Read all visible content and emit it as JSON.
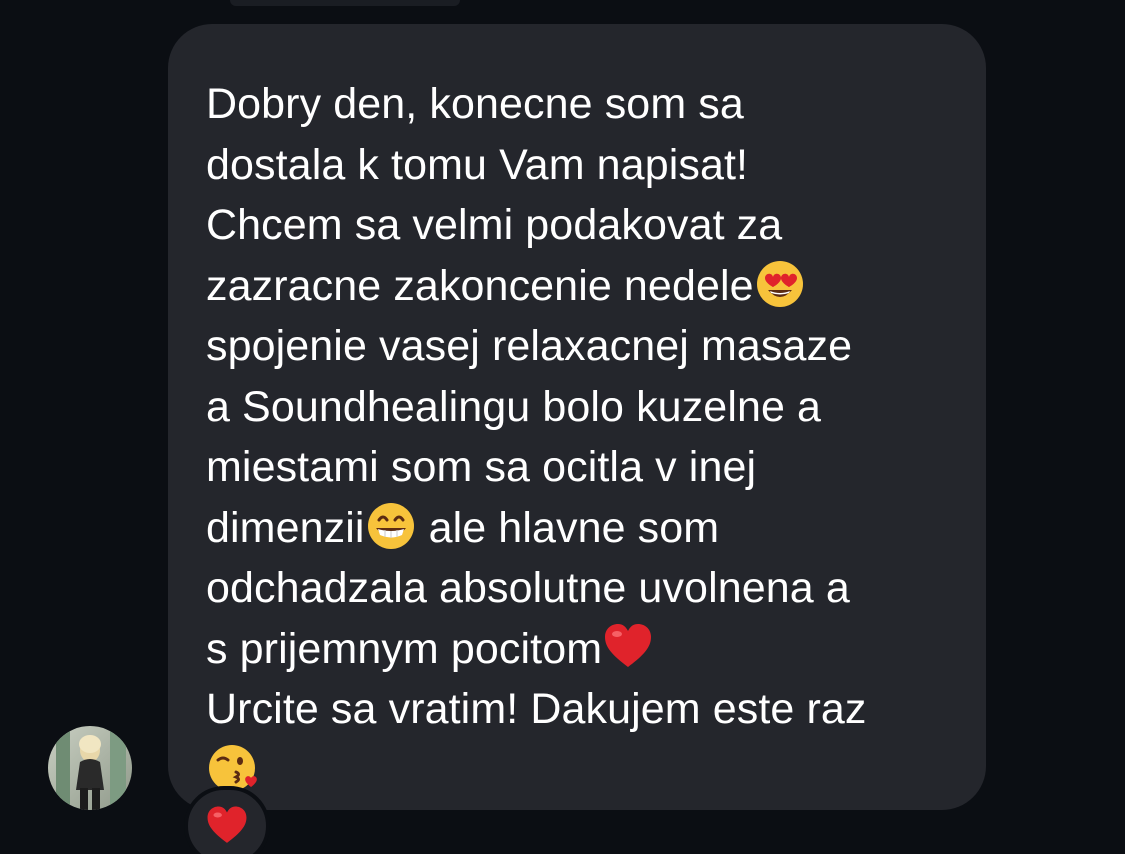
{
  "message": {
    "lines": [
      "Dobry den, konecne som sa",
      "dostala k tomu Vam napisat!",
      "Chcem sa velmi podakovat za",
      "zazracne zakoncenie nedele",
      "spojenie vasej relaxacnej masaze",
      "a Soundhealingu bolo kuzelne a",
      "miestami som sa ocitla v inej",
      "dimenzii",
      " ale hlavne som",
      "odchadzala absolutne uvolnena a",
      "s prijemnym pocitom",
      "Urcite sa vratim! Dakujem este raz"
    ],
    "emojis": {
      "line4": "heart-eyes-emoji",
      "line8": "grinning-emoji",
      "line11": "red-heart-emoji",
      "line13": "kissing-heart-emoji"
    }
  },
  "reaction": {
    "emoji": "red-heart-emoji"
  },
  "sender": {
    "avatar": "user-avatar"
  },
  "colors": {
    "background": "#0b0e13",
    "bubble": "#24262c",
    "text": "#ffffff",
    "heart": "#e0232b",
    "emoji_yellow": "#f7c33b"
  }
}
